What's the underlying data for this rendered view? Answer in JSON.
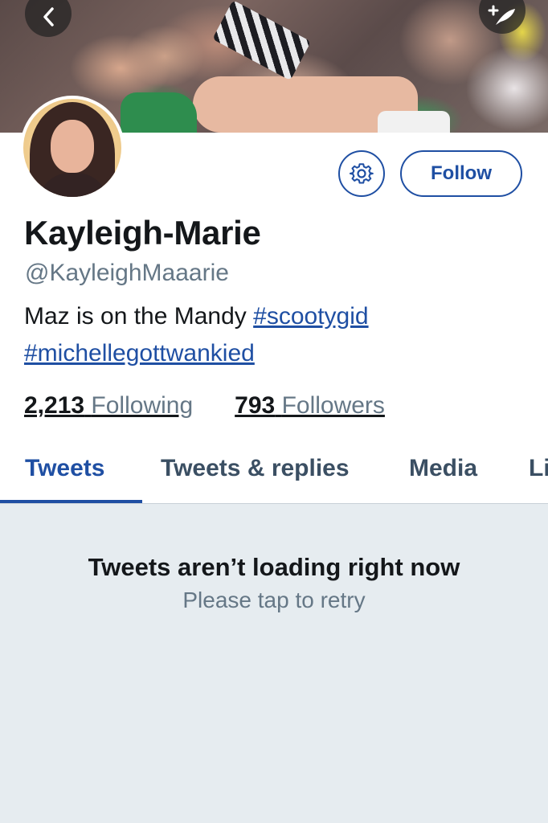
{
  "header": {
    "back_icon": "chevron-left-icon",
    "compose_icon": "compose-feather-icon"
  },
  "profile": {
    "name": "Kayleigh-Marie",
    "handle": "@KayleighMaaarie",
    "bio_text": "Maz is on the Mandy ",
    "bio_hashtags": [
      "#scootygid",
      "#michellegottwankied"
    ],
    "follow_label": "Follow",
    "settings_icon": "gear-icon",
    "following_count": "2,213",
    "following_label": "Following",
    "followers_count": "793",
    "followers_label": "Followers"
  },
  "tabs": [
    {
      "label": "Tweets",
      "active": true
    },
    {
      "label": "Tweets & replies",
      "active": false
    },
    {
      "label": "Media",
      "active": false
    },
    {
      "label": "Li",
      "active": false
    }
  ],
  "content": {
    "error_title": "Tweets aren’t loading right now",
    "error_subtitle": "Please tap to retry"
  },
  "colors": {
    "accent": "#1f4fa3",
    "muted_text": "#657786",
    "content_bg": "#e6ecf0"
  }
}
